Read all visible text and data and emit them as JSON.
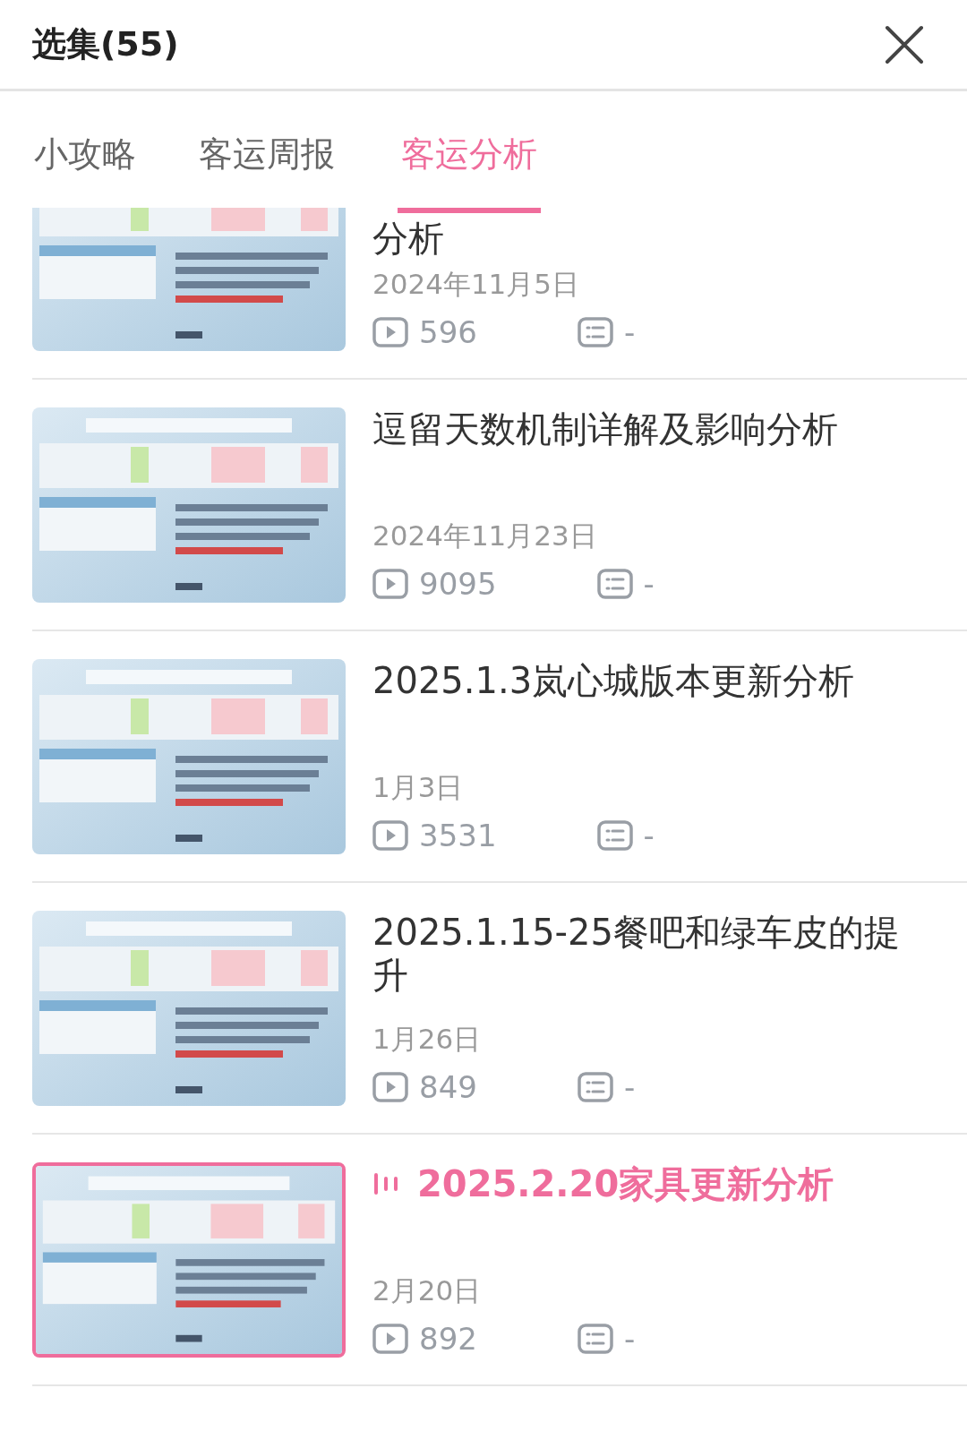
{
  "header": {
    "title": "选集(55)"
  },
  "tabs": [
    {
      "label": "小攻略",
      "selected": false
    },
    {
      "label": "客运周报",
      "selected": false
    },
    {
      "label": "客运分析",
      "selected": true
    }
  ],
  "episodes": [
    {
      "kind": "picture",
      "title": "分析",
      "date": "2024年11月5日",
      "plays": "596",
      "comments": "-",
      "selected": false
    },
    {
      "kind": "picture",
      "title": "逗留天数机制详解及影响分析",
      "date": "2024年11月23日",
      "plays": "9095",
      "comments": "-",
      "selected": false
    },
    {
      "kind": "picture",
      "title": "2025.1.3岚心城版本更新分析",
      "date": "1月3日",
      "plays": "3531",
      "comments": "-",
      "selected": false
    },
    {
      "kind": "picture",
      "title": "2025.1.15-25餐吧和绿车皮的提升",
      "date": "1月26日",
      "plays": "849",
      "comments": "-",
      "selected": false
    },
    {
      "kind": "picture",
      "title": "2025.2.20家具更新分析",
      "date": "2月20日",
      "plays": "892",
      "comments": "-",
      "selected": true
    }
  ]
}
